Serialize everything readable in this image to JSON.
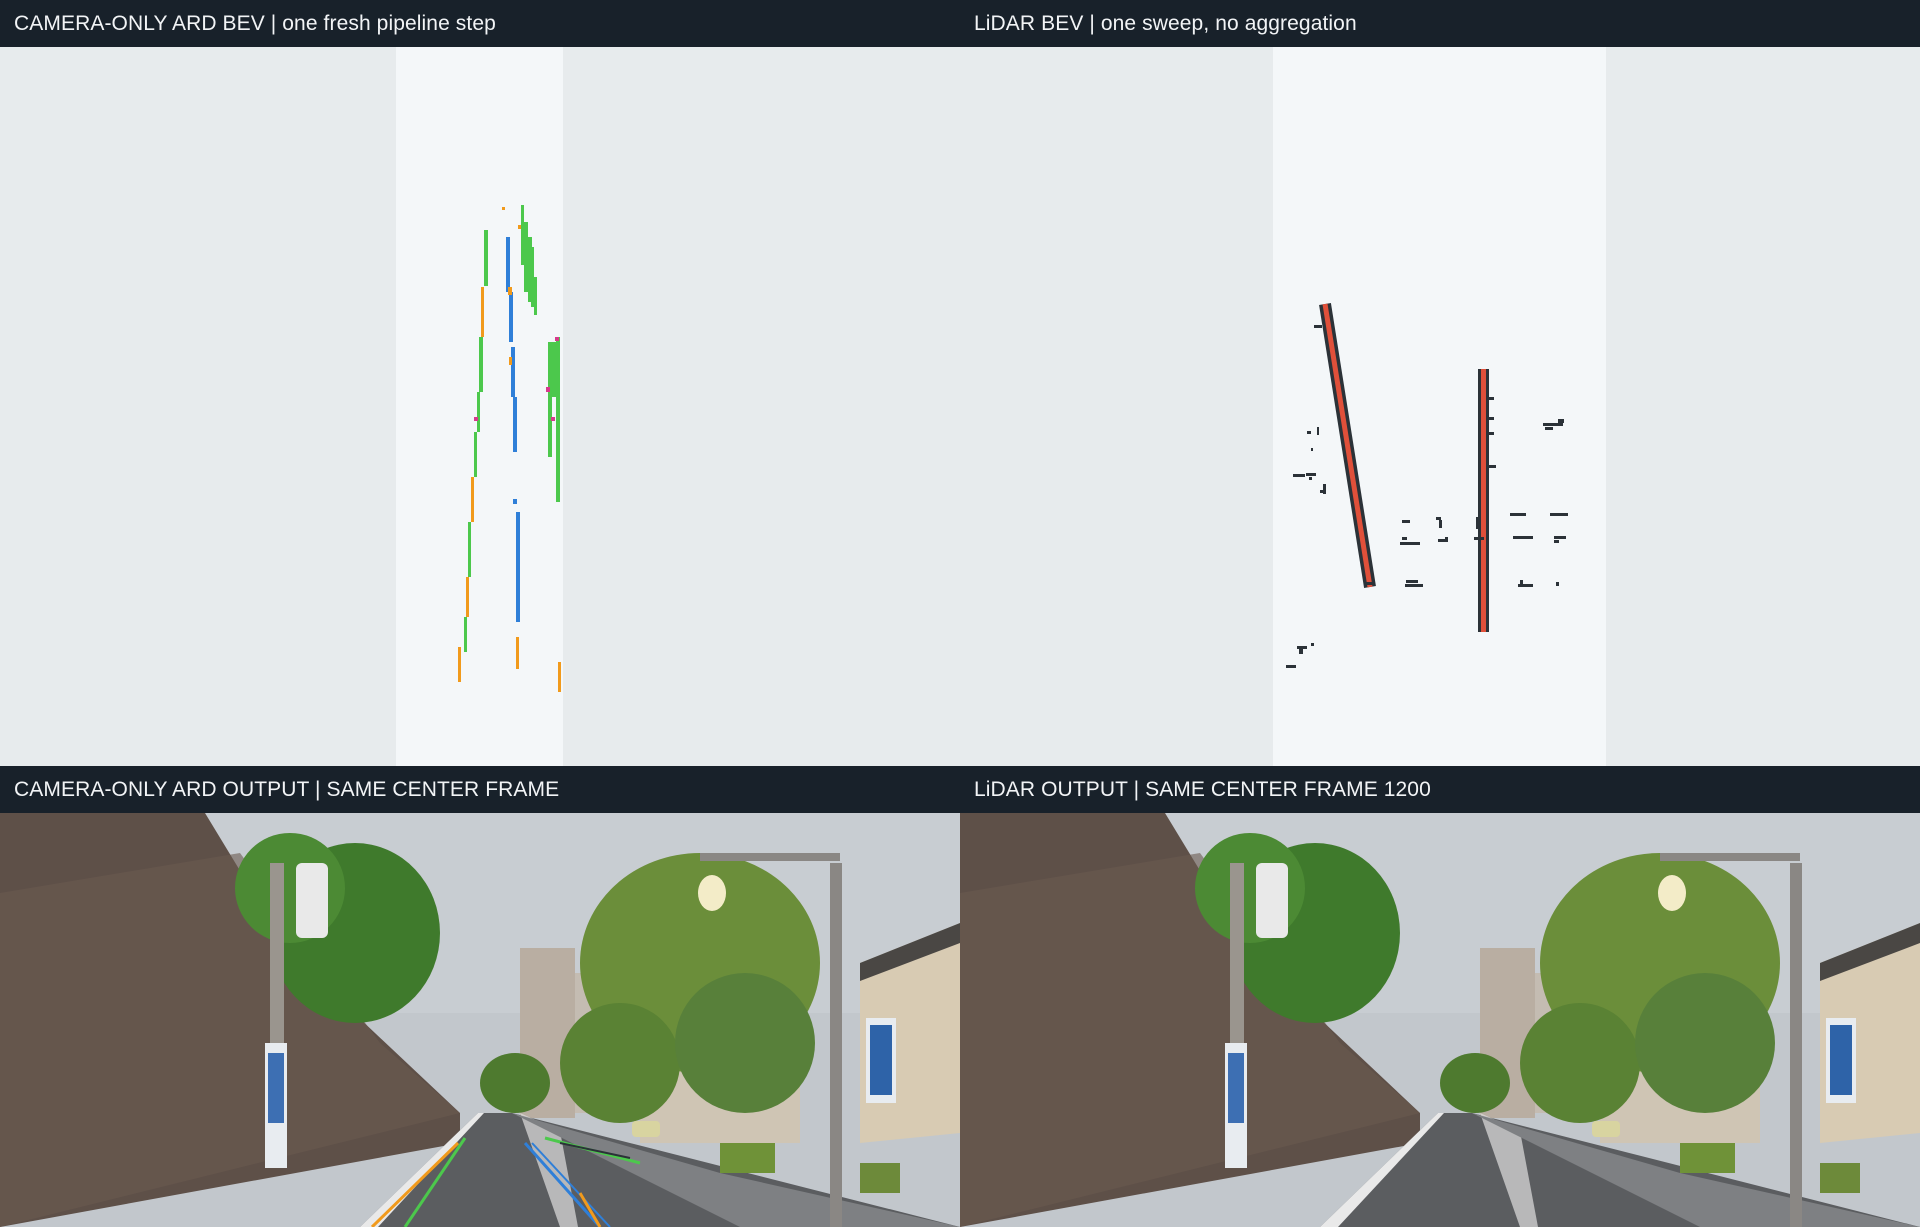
{
  "panels": {
    "top_left": {
      "title": "CAMERA-ONLY ARD BEV | one fresh pipeline step"
    },
    "top_right": {
      "title": "LiDAR BEV | one sweep, no aggregation"
    },
    "bottom_left": {
      "title": "CAMERA-ONLY ARD OUTPUT | SAME CENTER FRAME"
    },
    "bottom_right": {
      "title": "LiDAR OUTPUT | SAME CENTER FRAME 1200"
    }
  },
  "colors": {
    "header_bg": "#18212a",
    "plot_bg": "#e7ebed",
    "roi_bg": "#f4f7f9",
    "green": "#4cc84c",
    "orange": "#f19a1c",
    "blue": "#2f7fd8",
    "magenta": "#d63a8c",
    "lidar_red": "#e0503a",
    "lidar_dark": "#2b3238"
  }
}
